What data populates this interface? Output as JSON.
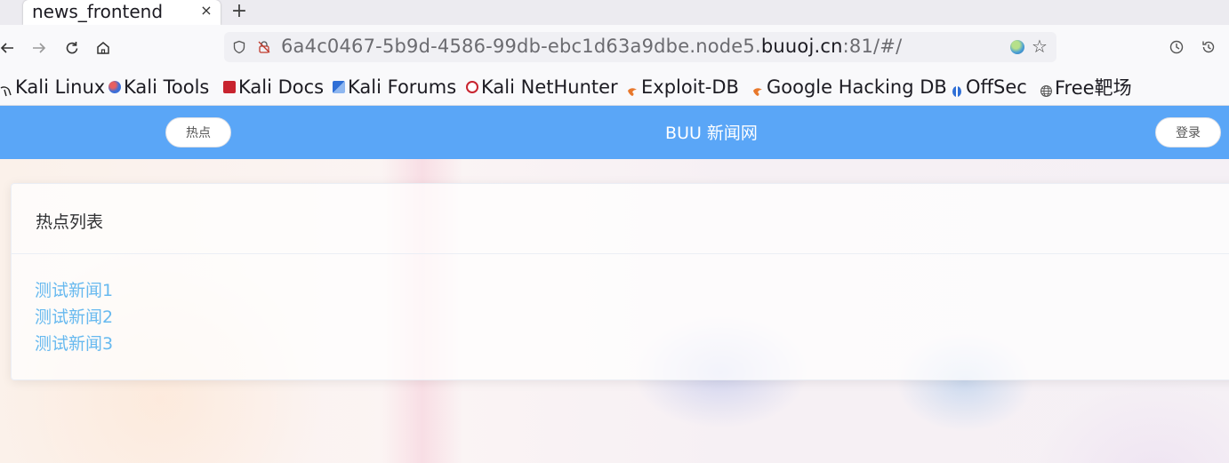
{
  "browser": {
    "tab": {
      "title": "news_frontend",
      "close_glyph": "×"
    },
    "new_tab_glyph": "+",
    "url": {
      "prefix": "6a4c0467-5b9d-4586-99db-ebc1d63a9dbe.node5.",
      "domain": "buuoj.cn",
      "suffix": ":81/#/"
    },
    "bookmarks": [
      {
        "label": "Kali Linux",
        "icon": "kali-dragon-icon",
        "color": "#222222"
      },
      {
        "label": "Kali Tools",
        "icon": "kali-tools-icon",
        "color": "#3d6fd8"
      },
      {
        "label": "Kali Docs",
        "icon": "kali-docs-icon",
        "color": "#c8242f"
      },
      {
        "label": "Kali Forums",
        "icon": "kali-forums-icon",
        "color": "#2f6fd6"
      },
      {
        "label": "Kali NetHunter",
        "icon": "nethunter-icon",
        "color": "#c8242f"
      },
      {
        "label": "Exploit-DB",
        "icon": "exploit-db-icon",
        "color": "#e8782c"
      },
      {
        "label": "Google Hacking DB",
        "icon": "ghdb-icon",
        "color": "#e8782c"
      },
      {
        "label": "OffSec",
        "icon": "offsec-icon",
        "color": "#2f6fd6"
      },
      {
        "label": "Free靶场",
        "icon": "globe-icon",
        "color": "#555555"
      }
    ]
  },
  "page": {
    "accent_color": "#5aa6f7",
    "header": {
      "hot_button": "热点",
      "title": "BUU 新闻网",
      "login_button": "登录"
    },
    "card": {
      "title": "热点列表",
      "news": [
        "测试新闻1",
        "测试新闻2",
        "测试新闻3"
      ]
    }
  }
}
